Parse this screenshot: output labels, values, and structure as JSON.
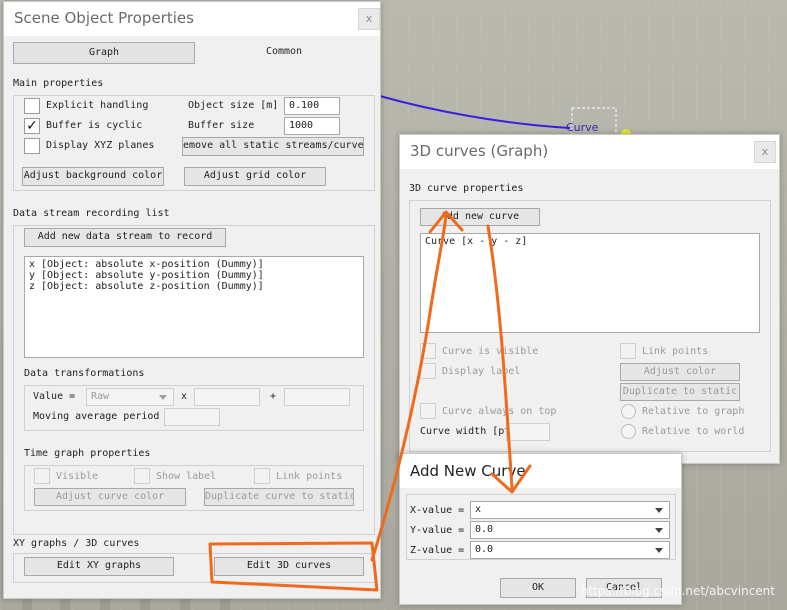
{
  "background": {
    "curve_label": "Curve",
    "watermark": "https://blog.csdn.net/abcvincent"
  },
  "scene_props": {
    "title": "Scene Object Properties",
    "close": "x",
    "tabs": [
      "Graph",
      "Common"
    ],
    "main": {
      "heading": "Main properties",
      "explicit_handling": {
        "label": "Explicit handling",
        "checked": false
      },
      "buffer_cyclic": {
        "label": "Buffer is cyclic",
        "checked": true
      },
      "display_xyz": {
        "label": "Display XYZ planes",
        "checked": false
      },
      "object_size_label": "Object size [m]",
      "object_size_value": "0.100",
      "buffer_size_label": "Buffer size",
      "buffer_size_value": "1000",
      "remove_streams": "emove all static streams/curve",
      "adjust_bg": "Adjust background color",
      "adjust_grid": "Adjust grid color"
    },
    "recording": {
      "heading": "Data stream recording list",
      "add_button": "Add new data stream to record",
      "items": [
        "x [Object: absolute x-position (Dummy)]",
        "y [Object: absolute y-position (Dummy)]",
        "z [Object: absolute z-position (Dummy)]"
      ]
    },
    "transform": {
      "heading": "Data transformations",
      "value_label": "Value =",
      "value_select": "Raw",
      "x_sign": "x",
      "plus_sign": "+",
      "moving_avg": "Moving average period"
    },
    "time_graph": {
      "heading": "Time graph properties",
      "visible": "Visible",
      "show_label": "Show label",
      "link_points": "Link points",
      "adjust_color": "Adjust curve color",
      "duplicate": "Duplicate curve to static"
    },
    "xy": {
      "heading": "XY graphs / 3D curves",
      "edit_xy": "Edit XY graphs",
      "edit_3d": "Edit 3D curves"
    }
  },
  "curves3d": {
    "title": "3D curves (Graph)",
    "close": "x",
    "heading": "3D curve properties",
    "add_button": "Add new curve",
    "list_item": "Curve [x - y - z]",
    "curve_visible": "Curve is visible",
    "link_points": "Link points",
    "display_label": "Display label",
    "adjust_color": "Adjust color",
    "duplicate": "Duplicate to static",
    "always_on_top": "Curve always on top",
    "relative_graph": "Relative to graph",
    "curve_width": "Curve width [pt",
    "relative_world": "Relative to world"
  },
  "add_curve": {
    "title": "Add New Curve",
    "x_label": "X-value =",
    "x_value": "x",
    "y_label": "Y-value =",
    "y_value": "0.0",
    "z_label": "Z-value =",
    "z_value": "0.0",
    "ok": "OK",
    "cancel": "Cancel"
  },
  "colors": {
    "annotation": "#f06a1e",
    "curve_line": "#3a1ee0"
  }
}
